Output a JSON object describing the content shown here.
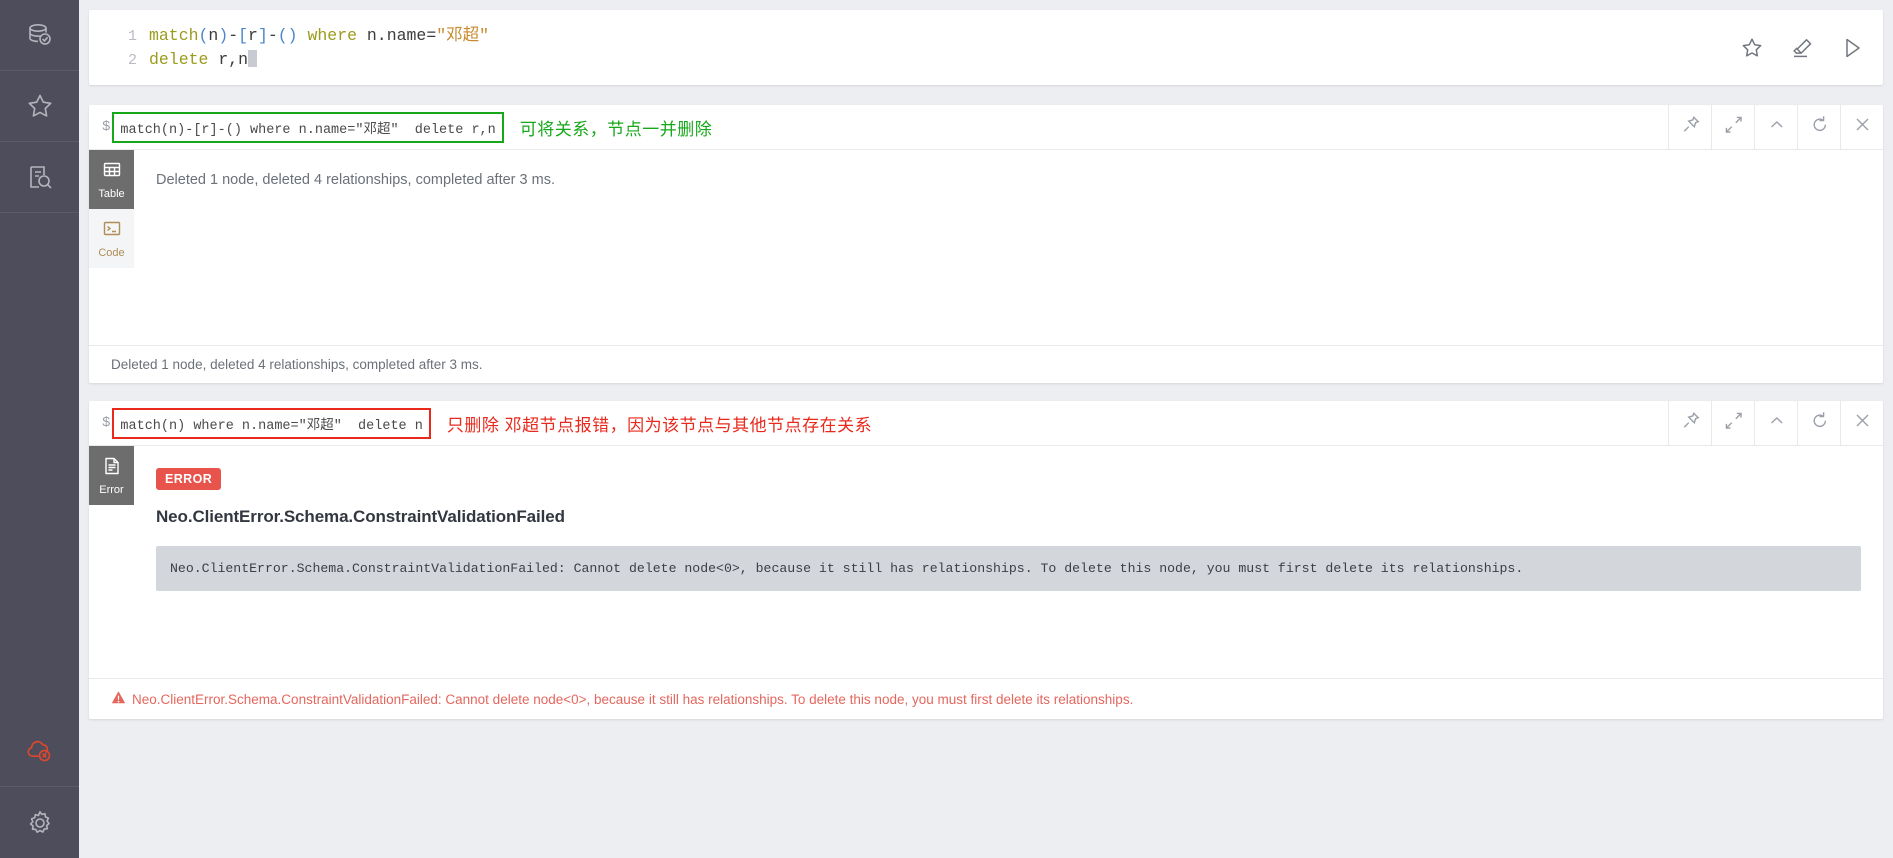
{
  "sidebar": {
    "top_items": [
      {
        "name": "database-check-icon",
        "label": "Database Information"
      },
      {
        "name": "star-icon",
        "label": "Favorites"
      },
      {
        "name": "document-search-icon",
        "label": "Browser Guides"
      }
    ],
    "bottom_items": [
      {
        "name": "cloud-disconnected-icon",
        "label": "Browser Sync Disconnected"
      },
      {
        "name": "gear-icon",
        "label": "Settings"
      }
    ]
  },
  "editor": {
    "lines": [
      {
        "number": "1",
        "tokens": [
          {
            "cls": "kw",
            "t": "match"
          },
          {
            "cls": "pn",
            "t": "("
          },
          {
            "cls": "id",
            "t": "n"
          },
          {
            "cls": "pn",
            "t": ")"
          },
          {
            "cls": "op",
            "t": "-"
          },
          {
            "cls": "pn",
            "t": "["
          },
          {
            "cls": "id",
            "t": "r"
          },
          {
            "cls": "pn",
            "t": "]"
          },
          {
            "cls": "op",
            "t": "-"
          },
          {
            "cls": "pn",
            "t": "()"
          },
          {
            "cls": "id",
            "t": " "
          },
          {
            "cls": "kw",
            "t": "where"
          },
          {
            "cls": "id",
            "t": " n.name"
          },
          {
            "cls": "op",
            "t": "="
          },
          {
            "cls": "st",
            "t": "\"邓超\""
          }
        ]
      },
      {
        "number": "2",
        "tokens": [
          {
            "cls": "kw",
            "t": "delete"
          },
          {
            "cls": "id",
            "t": " r,n"
          }
        ]
      }
    ],
    "tools": [
      {
        "name": "favorite-star-icon",
        "label": "Add to Favorites"
      },
      {
        "name": "eraser-icon",
        "label": "Clear Editor"
      },
      {
        "name": "run-play-icon",
        "label": "Run Query"
      }
    ]
  },
  "frame_tools": [
    {
      "name": "pin-icon",
      "label": "Pin"
    },
    {
      "name": "expand-icon",
      "label": "Fullscreen"
    },
    {
      "name": "chevron-up-icon",
      "label": "Collapse"
    },
    {
      "name": "refresh-icon",
      "label": "Rerun"
    },
    {
      "name": "close-icon",
      "label": "Close"
    }
  ],
  "frames": [
    {
      "prompt": "$",
      "command": "match(n)-[r]-() where n.name=\"邓超\"  delete r,n",
      "highlight": "green",
      "annotation": "可将关系，节点一并删除",
      "annotation_color": "#17a81a",
      "tabs": [
        {
          "name": "tab-table",
          "label": "Table",
          "icon": "table-icon",
          "active": true
        },
        {
          "name": "tab-code",
          "label": "Code",
          "icon": "terminal-icon",
          "active": false
        }
      ],
      "result_message": "Deleted 1 node, deleted 4 relationships, completed after 3 ms.",
      "status_bar": "Deleted 1 node, deleted 4 relationships, completed after 3 ms."
    },
    {
      "prompt": "$",
      "command": "match(n) where n.name=\"邓超\"  delete n",
      "highlight": "red",
      "annotation": "只删除 邓超节点报错，因为该节点与其他节点存在关系",
      "annotation_color": "#e8291c",
      "tabs": [
        {
          "name": "tab-error",
          "label": "Error",
          "icon": "document-icon",
          "active": true
        }
      ],
      "error_badge": "ERROR",
      "error_title": "Neo.ClientError.Schema.ConstraintValidationFailed",
      "error_body": "Neo.ClientError.Schema.ConstraintValidationFailed: Cannot delete node<0>, because it still has relationships. To delete this node, you must first delete its relationships.",
      "status_bar": "Neo.ClientError.Schema.ConstraintValidationFailed: Cannot delete node<0>, because it still has relationships. To delete this node, you must first delete its relationships."
    }
  ],
  "colors": {
    "sidebar_bg": "#4e4d5c",
    "page_bg": "#eceef1",
    "error_red": "#e8544c",
    "annotation_green": "#17a81a",
    "annotation_red": "#e8291c",
    "tab_active_bg": "#6d6d6d"
  }
}
